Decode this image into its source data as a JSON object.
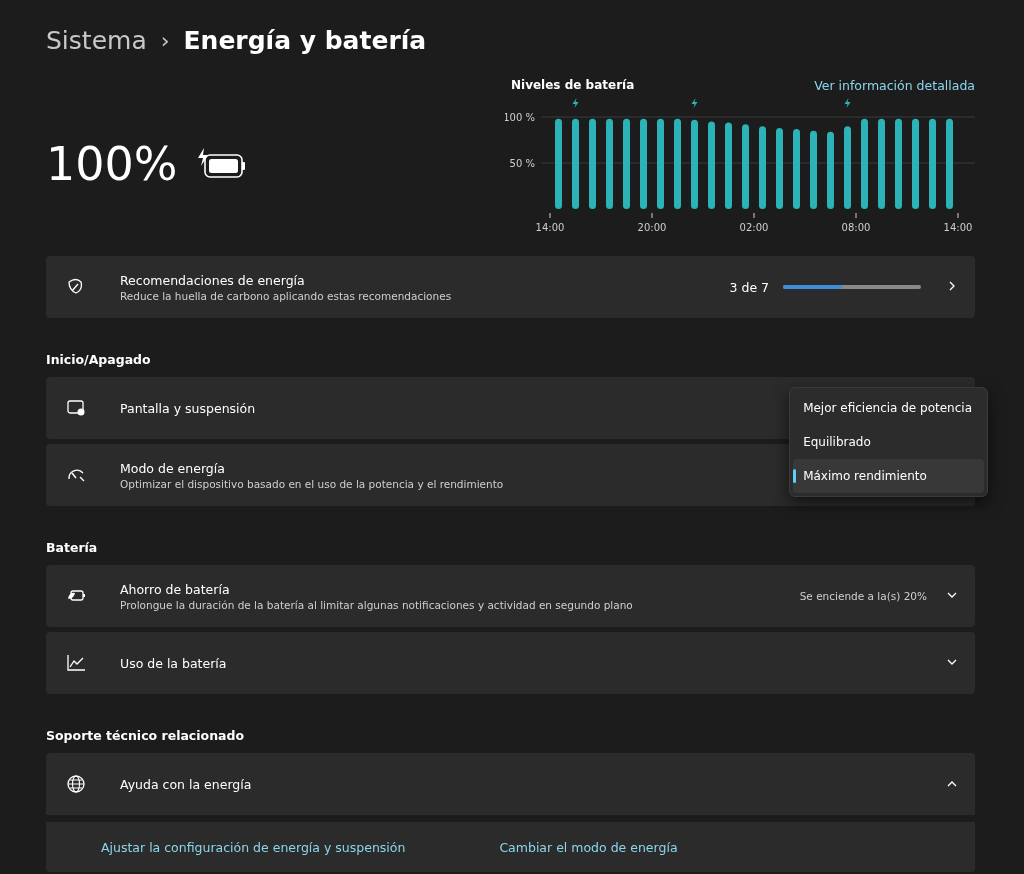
{
  "breadcrumb": {
    "parent": "Sistema",
    "separator": "›",
    "title": "Energía y batería"
  },
  "battery": {
    "percent": "100%",
    "charging": true
  },
  "levels": {
    "link": "Ver información detallada",
    "chart_data": {
      "type": "bar",
      "title": "Niveles de batería",
      "categories": [
        "14:00",
        null,
        null,
        null,
        null,
        null,
        "20:00",
        null,
        null,
        null,
        null,
        null,
        "02:00",
        null,
        null,
        null,
        null,
        null,
        "08:00",
        null,
        null,
        null,
        null,
        null,
        "14:00"
      ],
      "values": [
        98,
        98,
        98,
        98,
        98,
        98,
        98,
        98,
        97,
        95,
        94,
        92,
        90,
        88,
        87,
        85,
        84,
        90,
        98,
        98,
        98,
        98,
        98,
        98,
        null
      ],
      "ylim": [
        0,
        100
      ],
      "yticks": [
        {
          "value": 50,
          "label": "50 %"
        },
        {
          "value": 100,
          "label": "100 %"
        }
      ]
    },
    "charging": [
      false,
      true,
      false,
      false,
      false,
      false,
      false,
      false,
      true,
      false,
      false,
      false,
      false,
      false,
      false,
      false,
      false,
      true,
      false,
      false,
      false,
      false,
      false,
      false
    ]
  },
  "recommendations": {
    "title": "Recomendaciones de energía",
    "subtitle": "Reduce la huella de carbono aplicando estas recomendaciones",
    "count": "3 de 7",
    "level": 0.43
  },
  "sections": [
    {
      "heading": "Inicio/Apagado",
      "rows": [
        {
          "kind": "plain",
          "title": "Pantalla y suspensión"
        },
        {
          "kind": "dropdown",
          "title": "Modo de energía",
          "subtitle": "Optimizar el dispositivo basado en el uso de la potencia y el rendimiento",
          "menu": [
            {
              "label": "Mejor eficiencia de potencia",
              "selected": false
            },
            {
              "label": "Equilibrado",
              "selected": false
            },
            {
              "label": "Máximo rendimiento",
              "selected": true
            }
          ]
        }
      ]
    },
    {
      "heading": "Batería",
      "rows": [
        {
          "kind": "expander",
          "title": "Ahorro de batería",
          "subtitle": "Prolongue la duración de la batería al limitar algunas notificaciones y actividad en segundo plano",
          "value": "Se enciende a la(s) 20%",
          "expanded": false
        },
        {
          "kind": "expander",
          "title": "Uso de la batería",
          "expanded": false
        }
      ]
    },
    {
      "heading": "Soporte técnico relacionado",
      "rows": [
        {
          "kind": "expander",
          "title": "Ayuda con la energía",
          "expanded": true,
          "links": [
            "Ajustar la configuración de energía y suspensión",
            "Cambiar el modo de energía"
          ]
        }
      ]
    }
  ]
}
